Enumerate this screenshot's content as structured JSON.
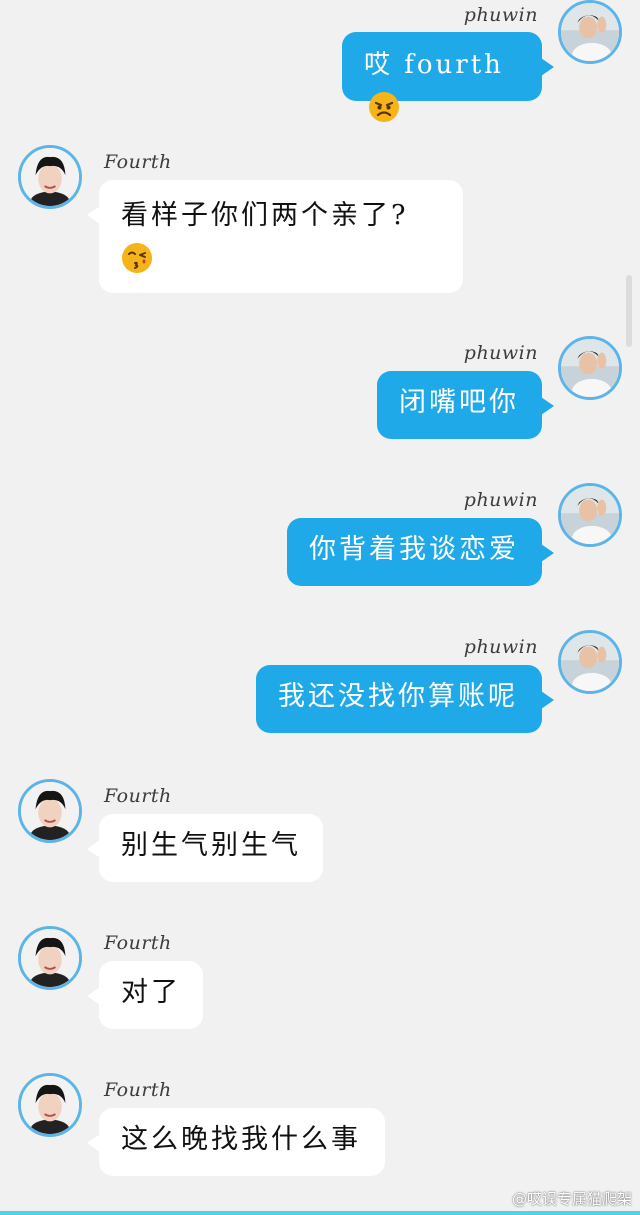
{
  "colors": {
    "background": "#f1f1f1",
    "incoming_bubble": "#ffffff",
    "outgoing_bubble": "#20a9e8",
    "avatar_ring": "#5db4e8"
  },
  "messages": [
    {
      "sender": "phuwin",
      "direction": "outgoing",
      "text": "哎 fourth",
      "emoji": "angry-face-emoji"
    },
    {
      "sender": "Fourth",
      "direction": "incoming",
      "text": "看样子你们两个亲了?",
      "emoji": "kissing-face-emoji"
    },
    {
      "sender": "phuwin",
      "direction": "outgoing",
      "text": "闭嘴吧你"
    },
    {
      "sender": "phuwin",
      "direction": "outgoing",
      "text": "你背着我谈恋爱"
    },
    {
      "sender": "phuwin",
      "direction": "outgoing",
      "text": "我还没找你算账呢"
    },
    {
      "sender": "Fourth",
      "direction": "incoming",
      "text": "别生气别生气"
    },
    {
      "sender": "Fourth",
      "direction": "incoming",
      "text": "对了"
    },
    {
      "sender": "Fourth",
      "direction": "incoming",
      "text": "这么晚找我什么事"
    }
  ],
  "watermark": "@哎误专属猫爬架"
}
